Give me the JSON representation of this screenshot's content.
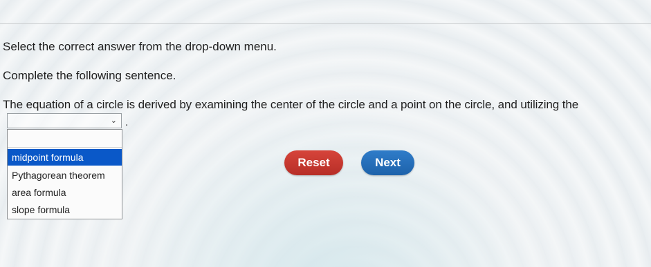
{
  "question": {
    "instruction": "Select the correct answer from the drop-down menu.",
    "prompt": "Complete the following sentence.",
    "sentence": "The equation of a circle is derived by examining the center of the circle and a point on the circle, and utilizing the",
    "sentence_end": "."
  },
  "dropdown": {
    "selected_value": "",
    "options": [
      "midpoint formula",
      "Pythagorean theorem",
      "area formula",
      "slope formula"
    ],
    "highlighted_option": "midpoint formula"
  },
  "buttons": {
    "reset_label": "Reset",
    "next_label": "Next"
  },
  "colors": {
    "reset": "#c0362e",
    "next": "#2770bb",
    "highlight": "#0a58c8"
  }
}
